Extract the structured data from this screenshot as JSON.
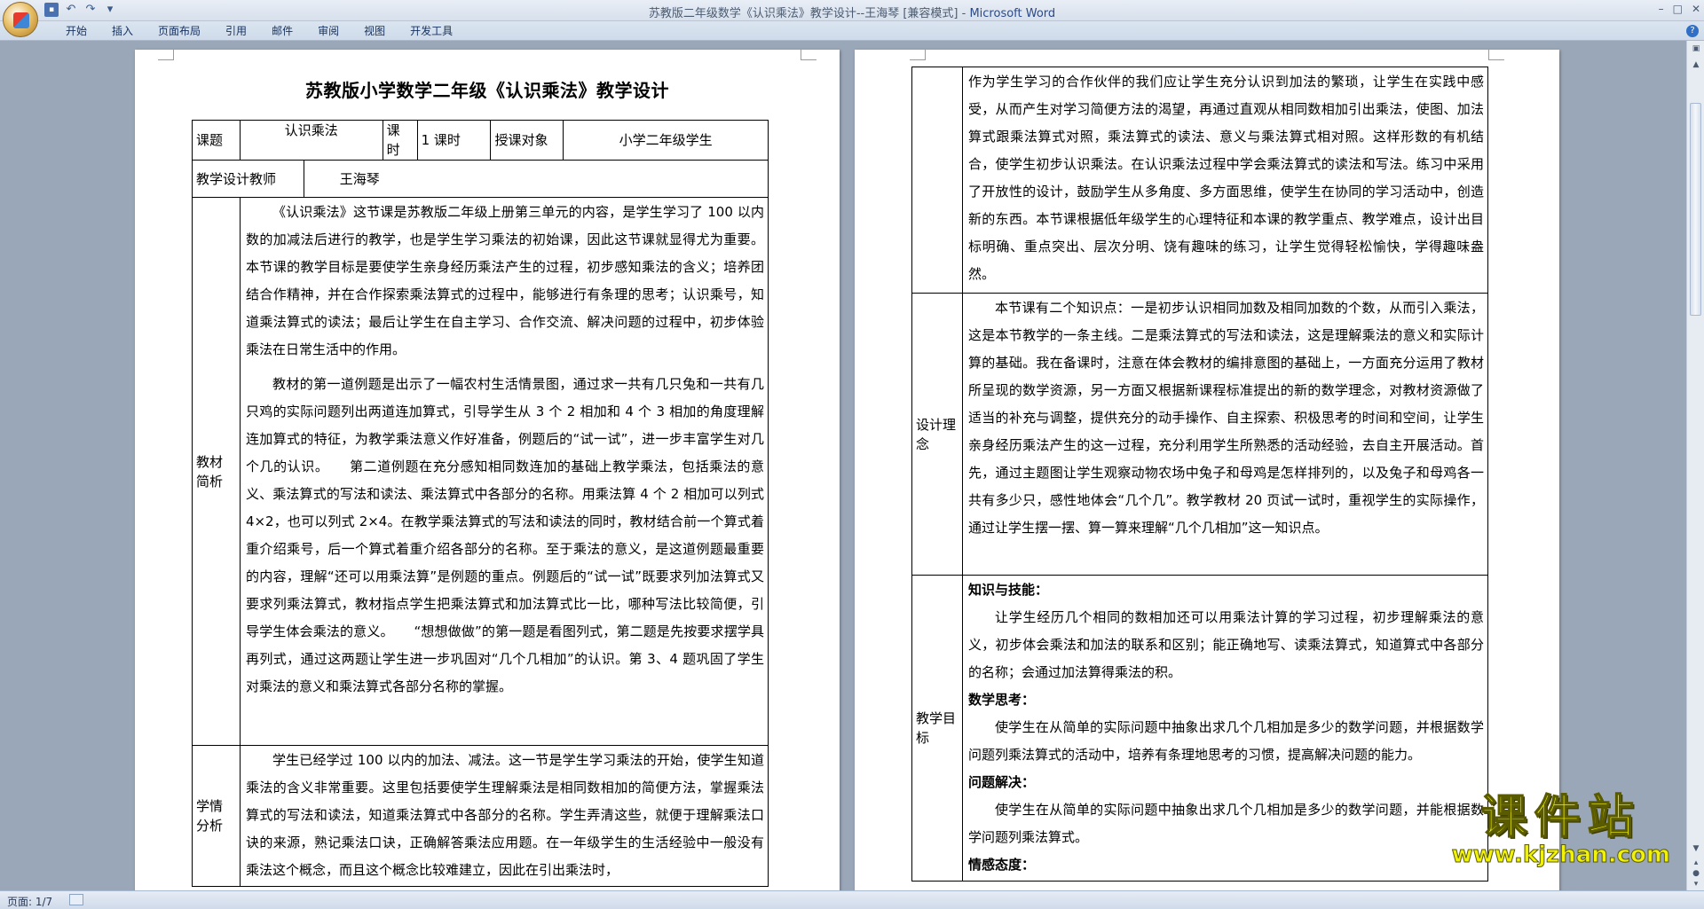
{
  "window": {
    "title_doc": "苏教版二年级数学《认识乘法》教学设计--王海琴 [兼容模式]",
    "title_sep": " - ",
    "title_app": "Microsoft Word"
  },
  "ribbon": {
    "tabs": [
      "开始",
      "插入",
      "页面布局",
      "引用",
      "邮件",
      "审阅",
      "视图",
      "开发工具"
    ]
  },
  "page1": {
    "title": "苏教版小学数学二年级《认识乘法》教学设计",
    "header": {
      "topic_label": "课题",
      "topic_value": "认识乘法",
      "hours_label": "课时",
      "hours_value": "1 课时",
      "audience_label": "授课对象",
      "audience_value": "小学二年级学生",
      "teacher_label": "教学设计教师",
      "teacher_value": "王海琴"
    },
    "material": {
      "label": "教材简析",
      "p1": "《认识乘法》这节课是苏教版二年级上册第三单元的内容，是学生学习了 100 以内数的加减法后进行的教学，也是学生学习乘法的初始课，因此这节课就显得尤为重要。本节课的教学目标是要使学生亲身经历乘法产生的过程，初步感知乘法的含义；培养团结合作精神，并在合作探索乘法算式的过程中，能够进行有条理的思考；认识乘号，知道乘法算式的读法；最后让学生在自主学习、合作交流、解决问题的过程中，初步体验乘法在日常生活中的作用。",
      "p2": "教材的第一道例题是出示了一幅农村生活情景图，通过求一共有几只兔和一共有几只鸡的实际问题列出两道连加算式，引导学生从 3 个 2 相加和 4 个 3 相加的角度理解连加算式的特征，为教学乘法意义作好准备，例题后的“试一试”，进一步丰富学生对几个几的认识。　　第二道例题在充分感知相同数连加的基础上教学乘法，包括乘法的意义、乘法算式的写法和读法、乘法算式中各部分的名称。用乘法算 4 个 2 相加可以列式 4×2，也可以列式 2×4。在教学乘法算式的写法和读法的同时，教材结合前一个算式着重介绍乘号，后一个算式着重介绍各部分的名称。至于乘法的意义，是这道例题最重要的内容，理解“还可以用乘法算”是例题的重点。例题后的“试一试”既要求列加法算式又要求列乘法算式，教材指点学生把乘法算式和加法算式比一比，哪种写法比较简便，引导学生体会乘法的意义。　　“想想做做”的第一题是看图列式，第二题是先按要求摆学具再列式，通过这两题让学生进一步巩固对“几个几相加”的认识。第 3、4 题巩固了学生对乘法的意义和乘法算式各部分名称的掌握。"
    },
    "learner": {
      "label": "学情分析",
      "p1": "学生已经学过 100 以内的加法、减法。这一节是学生学习乘法的开始，使学生知道乘法的含义非常重要。这里包括要使学生理解乘法是相同数相加的简便方法，掌握乘法算式的写法和读法，知道乘法算式中各部分的名称。学生弄清这些，就便于理解乘法口诀的来源，熟记乘法口诀，正确解答乘法应用题。在一年级学生的生活经验中一般没有乘法这个概念，而且这个概念比较难建立，因此在引出乘法时，"
    }
  },
  "page2": {
    "cont": {
      "p1": "作为学生学习的合作伙伴的我们应让学生充分认识到加法的繁琐，让学生在实践中感受，从而产生对学习简便方法的渴望，再通过直观从相同数相加引出乘法，使图、加法算式跟乘法算式对照，乘法算式的读法、意义与乘法算式相对照。这样形数的有机结合，使学生初步认识乘法。在认识乘法过程中学会乘法算式的读法和写法。练习中采用了开放性的设计，鼓励学生从多角度、多方面思维，使学生在协同的学习活动中，创造新的东西。本节课根据低年级学生的心理特征和本课的教学重点、教学难点，设计出目标明确、重点突出、层次分明、饶有趣味的练习，让学生觉得轻松愉快，学得趣味盎然。"
    },
    "concept": {
      "label": "设计理念",
      "p1": "本节课有二个知识点：一是初步认识相同加数及相同加数的个数，从而引入乘法，这是本节教学的一条主线。二是乘法算式的写法和读法，这是理解乘法的意义和实际计算的基础。我在备课时，注意在体会教材的编排意图的基础上，一方面充分运用了教材所呈现的数学资源，另一方面又根据新课程标准提出的新的数学理念，对教材资源做了适当的补充与调整，提供充分的动手操作、自主探索、积极思考的时间和空间，让学生亲身经历乘法产生的这一过程，充分利用学生所熟悉的活动经验，去自主开展活动。首先，通过主题图让学生观察动物农场中兔子和母鸡是怎样排列的，以及兔子和母鸡各一共有多少只，感性地体会“几个几”。教学教材 20 页试一试时，重视学生的实际操作，通过让学生摆一摆、算一算来理解“几个几相加”这一知识点。"
    },
    "goals": {
      "label": "教学目标",
      "h1": "知识与技能：",
      "p1": "让学生经历几个相同的数相加还可以用乘法计算的学习过程，初步理解乘法的意义，初步体会乘法和加法的联系和区别；能正确地写、读乘法算式，知道算式中各部分的名称；会通过加法算得乘法的积。",
      "h2": "数学思考：",
      "p2": "使学生在从简单的实际问题中抽象出求几个几相加是多少的数学问题，并根据数学问题列乘法算式的活动中，培养有条理地思考的习惯，提高解决问题的能力。",
      "h3": "问题解决：",
      "p3": "使学生在从简单的实际问题中抽象出求几个几相加是多少的数学问题，并能根据数学问题列乘法算式。",
      "h4": "情感态度："
    }
  },
  "status": {
    "page": "页面: 1/7"
  },
  "watermark": {
    "brand": "课件站",
    "url": "www.kjzhan.com"
  }
}
